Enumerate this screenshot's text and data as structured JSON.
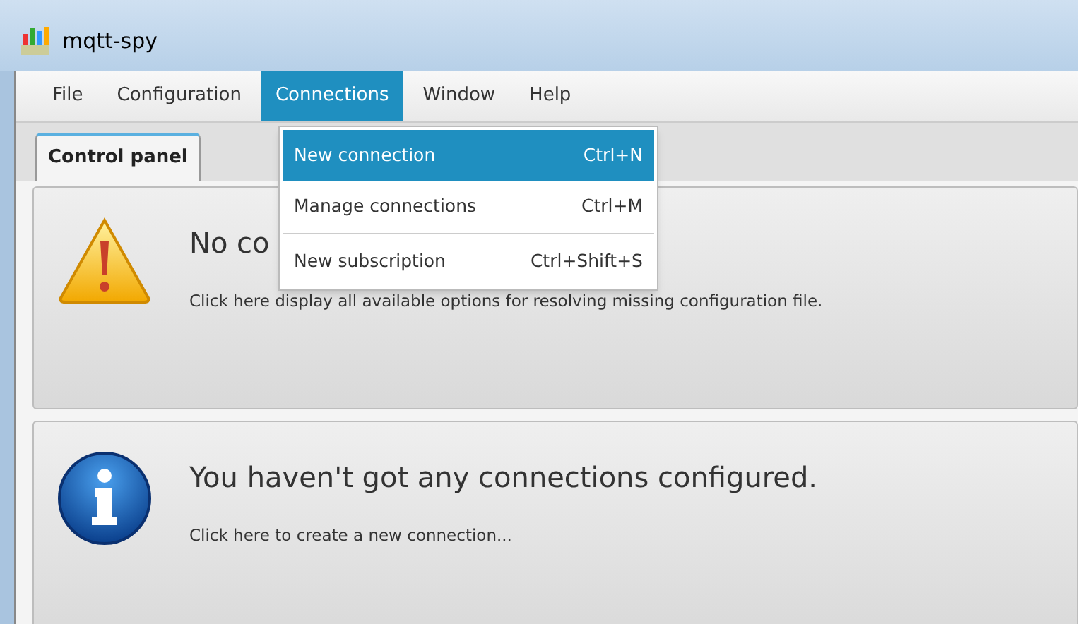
{
  "window": {
    "title": "mqtt-spy"
  },
  "menu_bar": [
    {
      "label": "File",
      "selected": false
    },
    {
      "label": "Configuration",
      "selected": false
    },
    {
      "label": "Connections",
      "selected": true
    },
    {
      "label": "Window",
      "selected": false
    },
    {
      "label": "Help",
      "selected": false
    }
  ],
  "menu": {
    "items": [
      {
        "label": "New connection",
        "shortcut": "Ctrl+N",
        "selected": true,
        "separator_before": false
      },
      {
        "label": "Manage connections",
        "shortcut": "Ctrl+M",
        "selected": false,
        "separator_before": false
      },
      {
        "label": "New subscription",
        "shortcut": "Ctrl+Shift+S",
        "selected": false,
        "separator_before": true
      }
    ]
  },
  "tabs": [
    {
      "label": "Control panel",
      "selected": true
    }
  ],
  "panels": [
    {
      "kind": "warning",
      "heading": "No co",
      "text": "Click here display all available options for resolving missing configuration file."
    },
    {
      "kind": "info",
      "heading": "You haven't got any connections configured.",
      "text": "Click here to create a new connection..."
    }
  ]
}
